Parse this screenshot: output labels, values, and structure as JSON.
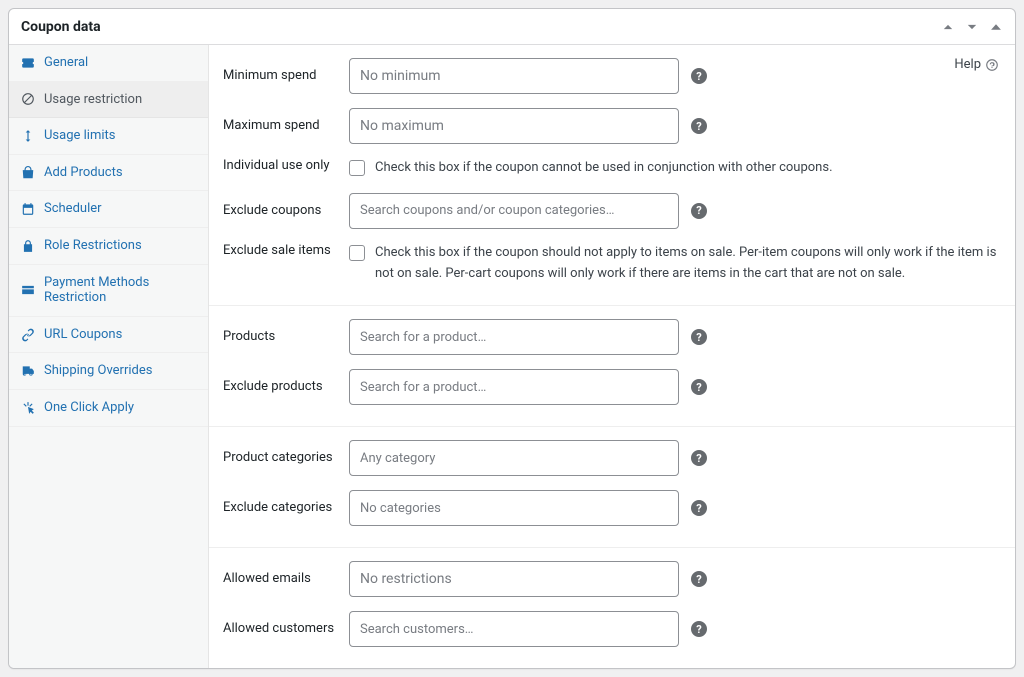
{
  "header": {
    "title": "Coupon data"
  },
  "help_label": "Help",
  "sidebar": {
    "items": [
      {
        "label": "General"
      },
      {
        "label": "Usage restriction"
      },
      {
        "label": "Usage limits"
      },
      {
        "label": "Add Products"
      },
      {
        "label": "Scheduler"
      },
      {
        "label": "Role Restrictions"
      },
      {
        "label": "Payment Methods Restriction"
      },
      {
        "label": "URL Coupons"
      },
      {
        "label": "Shipping Overrides"
      },
      {
        "label": "One Click Apply"
      }
    ]
  },
  "fields": {
    "min_spend": {
      "label": "Minimum spend",
      "placeholder": "No minimum"
    },
    "max_spend": {
      "label": "Maximum spend",
      "placeholder": "No maximum"
    },
    "individual": {
      "label": "Individual use only",
      "description": "Check this box if the coupon cannot be used in conjunction with other coupons."
    },
    "exclude_coupons": {
      "label": "Exclude coupons",
      "placeholder": "Search coupons and/or coupon categories…"
    },
    "exclude_sale": {
      "label": "Exclude sale items",
      "description": "Check this box if the coupon should not apply to items on sale. Per-item coupons will only work if the item is not on sale. Per-cart coupons will only work if there are items in the cart that are not on sale."
    },
    "products": {
      "label": "Products",
      "placeholder": "Search for a product…"
    },
    "exclude_products": {
      "label": "Exclude products",
      "placeholder": "Search for a product…"
    },
    "product_categories": {
      "label": "Product categories",
      "placeholder": "Any category"
    },
    "exclude_categories": {
      "label": "Exclude categories",
      "placeholder": "No categories"
    },
    "allowed_emails": {
      "label": "Allowed emails",
      "placeholder": "No restrictions"
    },
    "allowed_customers": {
      "label": "Allowed customers",
      "placeholder": "Search customers…"
    }
  }
}
